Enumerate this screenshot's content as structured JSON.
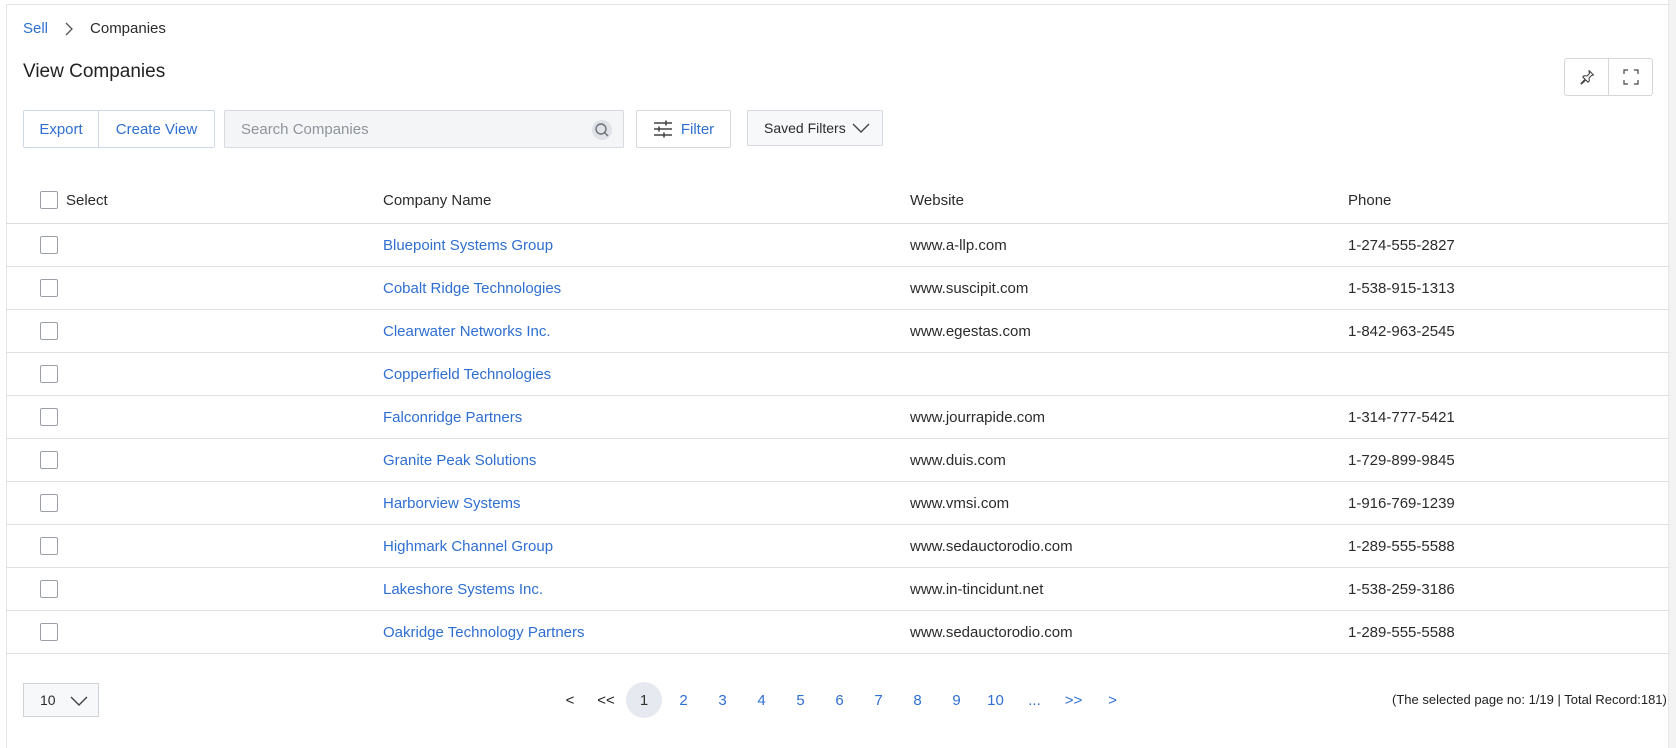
{
  "breadcrumb": {
    "root": "Sell",
    "current": "Companies"
  },
  "page": {
    "title": "View Companies"
  },
  "top_actions": {
    "pin_icon": "pin-icon",
    "expand_icon": "fullscreen-icon"
  },
  "toolbar": {
    "export_label": "Export",
    "create_view_label": "Create View",
    "search_placeholder": "Search Companies",
    "filter_label": "Filter",
    "saved_filters_label": "Saved Filters"
  },
  "table": {
    "columns": {
      "select": "Select",
      "name": "Company Name",
      "website": "Website",
      "phone": "Phone"
    },
    "rows": [
      {
        "name": "Bluepoint Systems Group",
        "website": "www.a-llp.com",
        "phone": "1-274-555-2827"
      },
      {
        "name": "Cobalt Ridge Technologies",
        "website": "www.suscipit.com",
        "phone": "1-538-915-1313"
      },
      {
        "name": "Clearwater Networks Inc.",
        "website": "www.egestas.com",
        "phone": "1-842-963-2545"
      },
      {
        "name": "Copperfield Technologies",
        "website": "",
        "phone": ""
      },
      {
        "name": "Falconridge Partners",
        "website": "www.jourrapide.com",
        "phone": "1-314-777-5421"
      },
      {
        "name": "Granite Peak Solutions",
        "website": "www.duis.com",
        "phone": "1-729-899-9845"
      },
      {
        "name": "Harborview Systems",
        "website": "www.vmsi.com",
        "phone": "1-916-769-1239"
      },
      {
        "name": "Highmark Channel Group",
        "website": "www.sedauctorodio.com",
        "phone": "1-289-555-5588"
      },
      {
        "name": "Lakeshore Systems Inc.",
        "website": "www.in-tincidunt.net",
        "phone": "1-538-259-3186"
      },
      {
        "name": "Oakridge Technology Partners",
        "website": "www.sedauctorodio.com",
        "phone": "1-289-555-5588"
      }
    ]
  },
  "pagination": {
    "page_size": "10",
    "prev": "<",
    "first": "<<",
    "pages": [
      "1",
      "2",
      "3",
      "4",
      "5",
      "6",
      "7",
      "8",
      "9",
      "10"
    ],
    "ellipsis": "...",
    "last": ">>",
    "next": ">",
    "active_page": "1",
    "info": "(The selected page no: 1/19 | Total Record:181)"
  },
  "colors": {
    "accent": "#2f6fd1",
    "border": "#d6d9de",
    "active_page_bg": "#e6eaf0"
  }
}
